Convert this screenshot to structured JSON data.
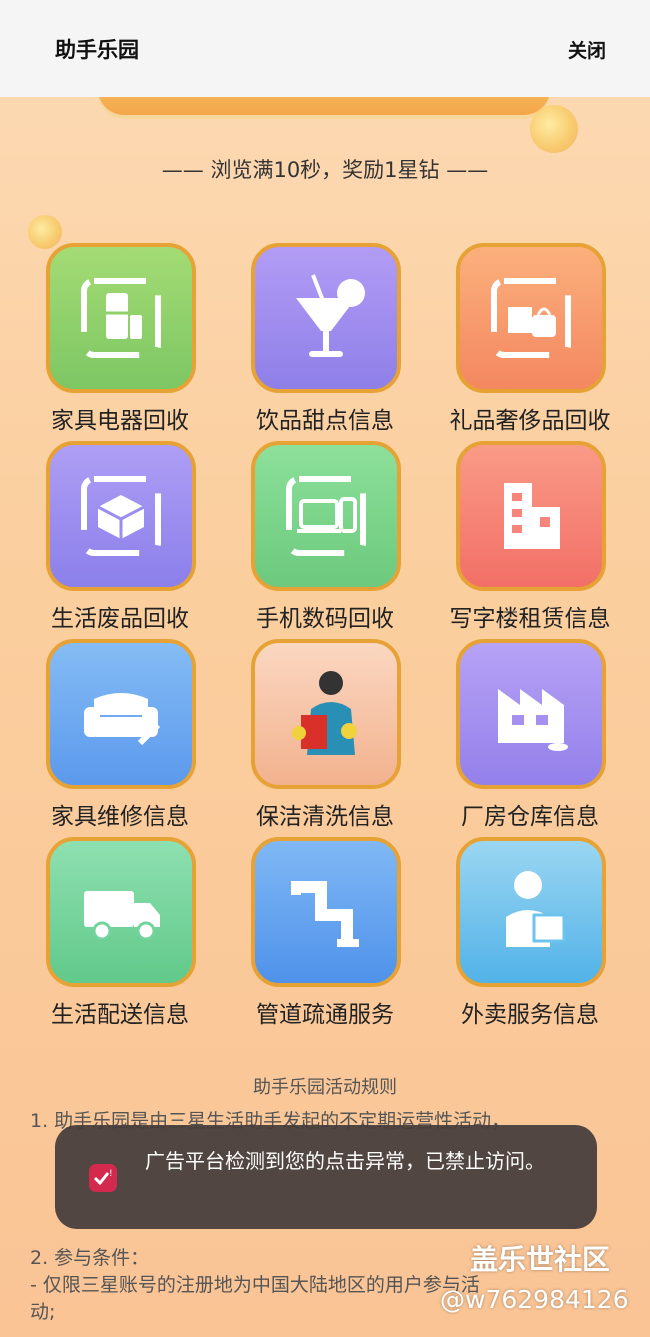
{
  "header": {
    "title": "助手乐园",
    "close_label": "关闭"
  },
  "subtitle": "—— 浏览满10秒，奖励1星钻 ——",
  "tiles": [
    {
      "label": "家具电器回收",
      "icon": "fridge-recycle-icon",
      "color": "#8fd06b"
    },
    {
      "label": "饮品甜点信息",
      "icon": "drink-icon",
      "color": "#a08ef0"
    },
    {
      "label": "礼品奢侈品回收",
      "icon": "gift-bag-recycle-icon",
      "color": "#f89a6d"
    },
    {
      "label": "生活废品回收",
      "icon": "box-recycle-icon",
      "color": "#9a8ef0"
    },
    {
      "label": "手机数码回收",
      "icon": "devices-recycle-icon",
      "color": "#7fd68a"
    },
    {
      "label": "写字楼租赁信息",
      "icon": "office-building-icon",
      "color": "#f7857a"
    },
    {
      "label": "家具维修信息",
      "icon": "sofa-wrench-icon",
      "color": "#6aaaf2"
    },
    {
      "label": "保洁清洗信息",
      "icon": "cleaner-woman-icon",
      "color": "#f5c3a5"
    },
    {
      "label": "厂房仓库信息",
      "icon": "factory-icon",
      "color": "#a58ff0"
    },
    {
      "label": "生活配送信息",
      "icon": "delivery-truck-icon",
      "color": "#72d39c"
    },
    {
      "label": "管道疏通服务",
      "icon": "pipe-icon",
      "color": "#63a6f2"
    },
    {
      "label": "外卖服务信息",
      "icon": "courier-box-icon",
      "color": "#6cc3ec"
    }
  ],
  "rules": {
    "title": "助手乐园活动规则",
    "lines": [
      "1. 助手乐园是由三星生活助手发起的不定期运营性活动，",
      "2. 参与条件：",
      "- 仅限三星账号的注册地为中国大陆地区的用户参与活",
      "  动;"
    ]
  },
  "toast": {
    "text": "广告平台检测到您的点击异常，已禁止访问。",
    "icon": "alert-check-icon",
    "icon_color": "#d4294f"
  },
  "watermark": {
    "brand": "盖乐世社区",
    "user": "@w762984126"
  }
}
